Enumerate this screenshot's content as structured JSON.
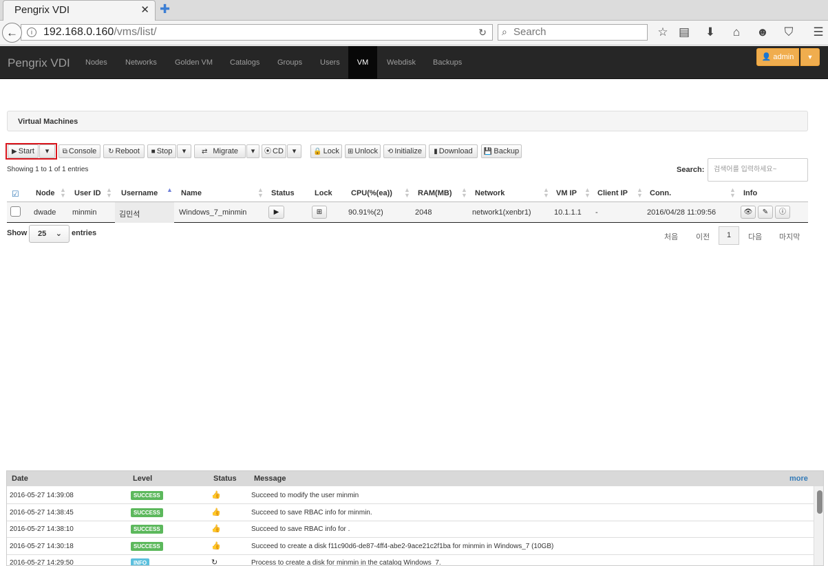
{
  "browser": {
    "tab_title": "Pengrix VDI",
    "url_host": "192.168.0.160",
    "url_path": "/vms/list/",
    "search_placeholder": "Search"
  },
  "app": {
    "brand": "Pengrix VDI",
    "nav": [
      "Nodes",
      "Networks",
      "Golden VM",
      "Catalogs",
      "Groups",
      "Users",
      "VM",
      "Webdisk",
      "Backups"
    ],
    "active_nav": "VM",
    "user": "admin"
  },
  "panel": {
    "title": "Virtual Machines"
  },
  "toolbar": {
    "start": "Start",
    "console": "Console",
    "reboot": "Reboot",
    "stop": "Stop",
    "migrate": "Migrate",
    "cd": "CD",
    "lock": "Lock",
    "unlock": "Unlock",
    "initialize": "Initialize",
    "download": "Download",
    "backup": "Backup"
  },
  "table_info": {
    "showing": "Showing 1 to 1 of 1 entries",
    "search_label": "Search:",
    "search_placeholder": "검색어를 입력하세요~"
  },
  "columns": [
    "Node",
    "User ID",
    "Username",
    "Name",
    "Status",
    "Lock",
    "CPU(%(ea))",
    "RAM(MB)",
    "Network",
    "VM IP",
    "Client IP",
    "Conn.",
    "Info"
  ],
  "rows": [
    {
      "node": "dwade",
      "user_id": "minmin",
      "username": "김민석",
      "name": "Windows_7_minmin",
      "cpu": "90.91%(2)",
      "ram": "2048",
      "network": "network1(xenbr1)",
      "vm_ip": "10.1.1.1",
      "client_ip": "-",
      "conn": "2016/04/28 11:09:56"
    }
  ],
  "length": {
    "show": "Show",
    "value": "25",
    "entries": "entries"
  },
  "pagination": {
    "first": "처음",
    "prev": "이전",
    "current": "1",
    "next": "다음",
    "last": "마지막"
  },
  "log": {
    "columns": [
      "Date",
      "Level",
      "Status",
      "Message"
    ],
    "more": "more",
    "rows": [
      {
        "date": "2016-05-27 14:39:08",
        "level": "SUCCESS",
        "message": "Succeed to modify the user minmin"
      },
      {
        "date": "2016-05-27 14:38:45",
        "level": "SUCCESS",
        "message": "Succeed to save RBAC info for minmin."
      },
      {
        "date": "2016-05-27 14:38:10",
        "level": "SUCCESS",
        "message": "Succeed to save RBAC info for ."
      },
      {
        "date": "2016-05-27 14:30:18",
        "level": "SUCCESS",
        "message": "Succeed to create a disk f11c90d6-de87-4ff4-abe2-9ace21c2f1ba for minmin in Windows_7 (10GB)"
      },
      {
        "date": "2016-05-27 14:29:50",
        "level": "INFO",
        "message": "Process to create a disk for minmin in the catalog Windows_7."
      }
    ]
  }
}
